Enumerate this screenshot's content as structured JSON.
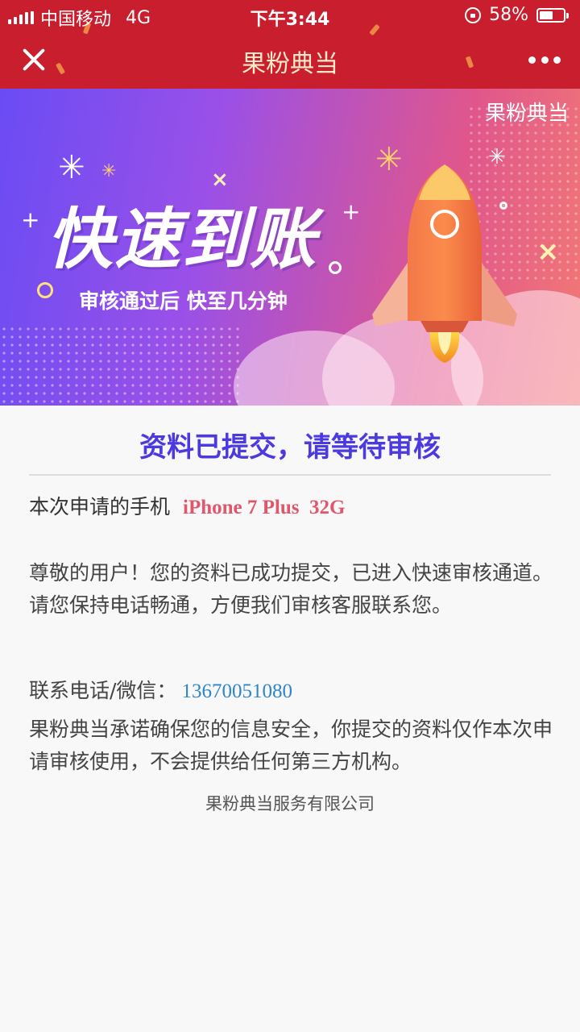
{
  "status_bar": {
    "carrier": "中国移动",
    "network": "4G",
    "time": "下午3:44",
    "battery_percent": "58%",
    "battery_level": 0.58
  },
  "nav": {
    "title": "果粉典当"
  },
  "banner": {
    "brand": "果粉典当",
    "headline": "快速到账",
    "subtitle": "审核通过后 快至几分钟"
  },
  "content": {
    "status_heading": "资料已提交，请等待审核",
    "phone_label": "本次申请的手机",
    "phone_model": "iPhone 7 Plus  32G",
    "message": "尊敬的用户！您的资料已成功提交，已进入快速审核通道。请您保持电话畅通，方便我们审核客服联系您。",
    "contact_label": "联系电话/微信：",
    "contact_number": "13670051080",
    "promise": "果粉典当承诺确保您的信息安全，你提交的资料仅作本次申请审核使用，不会提供给任何第三方机构。",
    "company": "果粉典当服务有限公司"
  },
  "colors": {
    "header_bg": "#c81e2e",
    "heading": "#4b3adf",
    "phone_model": "#e0566a",
    "contact_number": "#2e86c9"
  }
}
